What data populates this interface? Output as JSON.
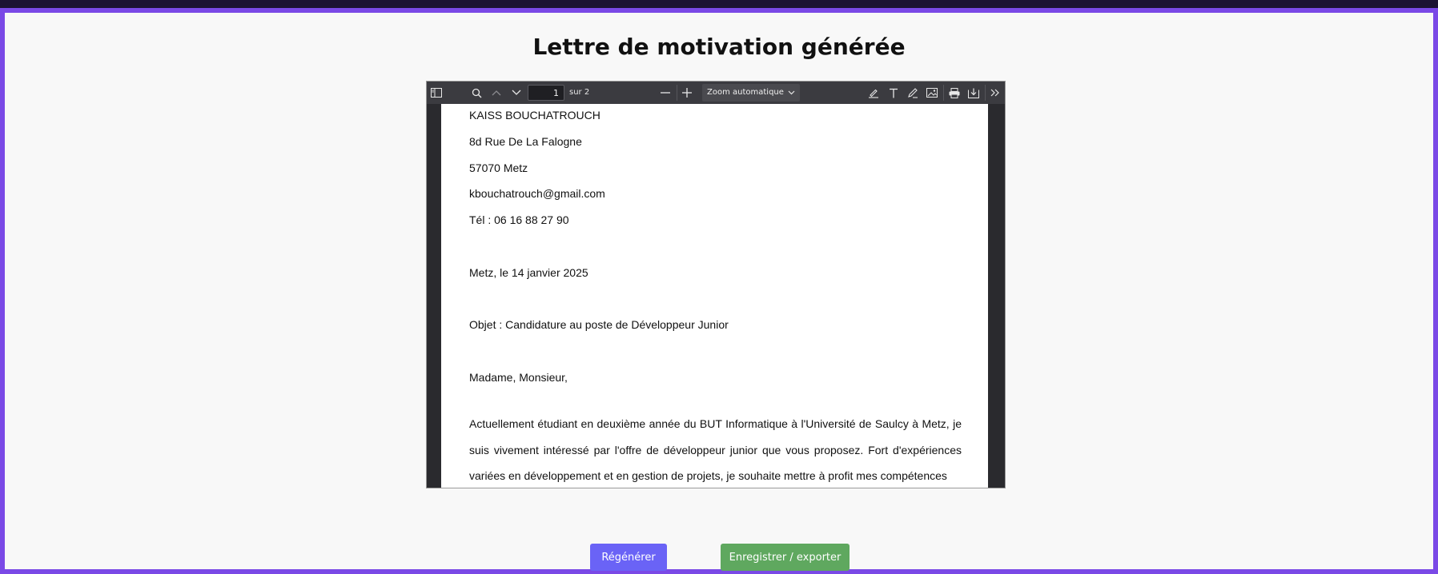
{
  "page": {
    "title": "Lettre de motivation générée"
  },
  "viewer": {
    "toolbar": {
      "page_number": "1",
      "page_count": "sur 2",
      "zoom": "Zoom automatique"
    },
    "letter": {
      "name": "KAISS BOUCHATROUCH",
      "address": "8d Rue De La Falogne",
      "city": "57070 Metz",
      "email": "kbouchatrouch@gmail.com",
      "phone": "Tél : 06 16 88 27 90",
      "date": "Metz, le 14 janvier 2025",
      "subject": "Objet : Candidature au poste de Développeur Junior",
      "greeting": "Madame, Monsieur,",
      "paragraph": "Actuellement étudiant en deuxième année du BUT Informatique à l'Université de Saulcy à Metz, je suis vivement intéressé par l'offre de développeur junior que vous proposez. Fort d'expériences variées en développement et en gestion de projets, je souhaite mettre à profit mes compétences"
    }
  },
  "actions": {
    "regenerate_label": "Régénérer",
    "export_label": "Enregistrer / exporter"
  },
  "icons": [
    "sidebar-toggle-icon",
    "search-icon",
    "chevron-up-icon",
    "chevron-down-icon",
    "minus-icon",
    "plus-icon",
    "highlight-icon",
    "text-icon",
    "draw-icon",
    "image-icon",
    "print-icon",
    "save-icon",
    "more-tools-icon"
  ],
  "colors": {
    "accent": "#7a49e6",
    "regenerate": "#6a63f6",
    "export": "#5fa85f"
  }
}
